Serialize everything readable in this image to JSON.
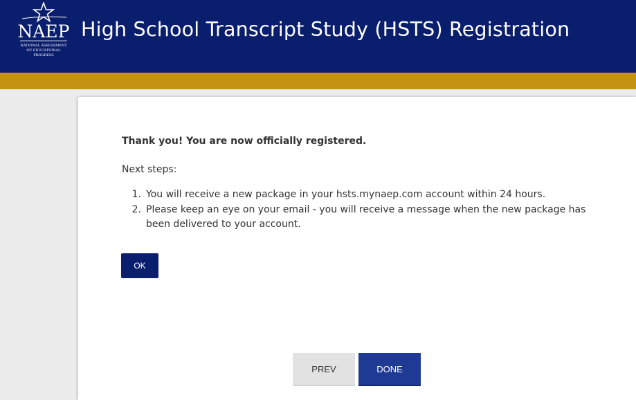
{
  "header": {
    "logo_text": "NAEP",
    "logo_subtext": [
      "NATIONAL ASSESSMENT",
      "OF EDUCATIONAL",
      "PROGRESS"
    ],
    "title": "High School Transcript Study (HSTS) Registration"
  },
  "colors": {
    "header_bg": "#0a1e6e",
    "gold_bar": "#c69214",
    "done_button": "#1f3a93",
    "prev_button": "#e2e2e2"
  },
  "main": {
    "thanks": "Thank you! You are now officially registered.",
    "next_steps_label": "Next steps:",
    "steps": [
      {
        "num": "1.",
        "text": "You will receive a new package in your hsts.mynaep.com account within 24 hours."
      },
      {
        "num": "2.",
        "text": "Please keep an eye on your email - you will receive a message when the new package has been delivered to your account."
      }
    ],
    "ok_label": "OK"
  },
  "footer": {
    "prev_label": "PREV",
    "done_label": "DONE"
  }
}
